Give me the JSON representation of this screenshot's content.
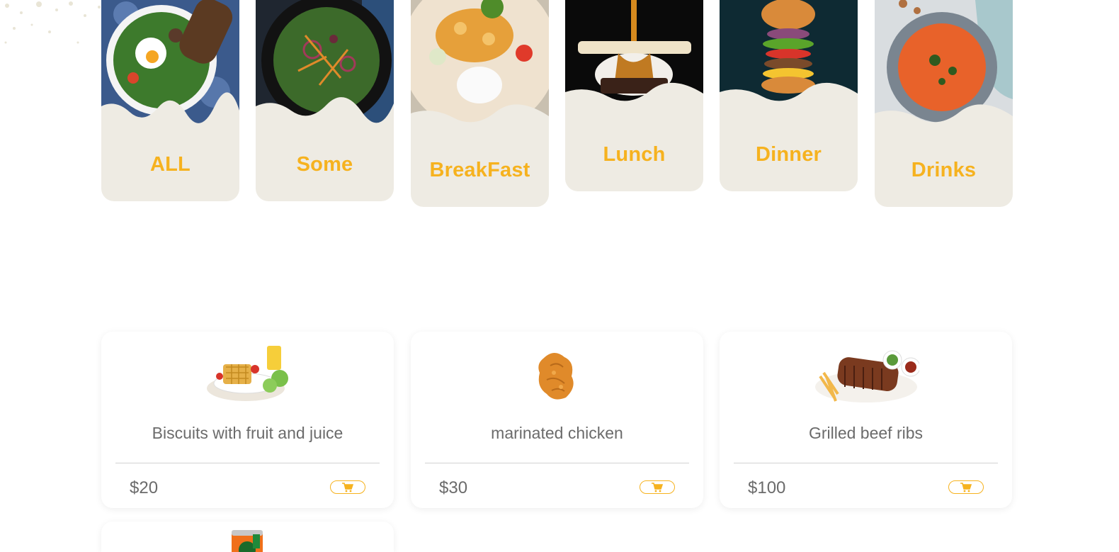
{
  "categories": [
    {
      "label": "ALL",
      "image": "salad-egg-bread-photo"
    },
    {
      "label": "Some",
      "image": "dark-salad-bowl-photo"
    },
    {
      "label": "BreakFast",
      "image": "rice-shrimp-plate-photo"
    },
    {
      "label": "Lunch",
      "image": "ice-cream-caramel-photo"
    },
    {
      "label": "Dinner",
      "image": "stacked-burger-photo"
    },
    {
      "label": "Drinks",
      "image": "tomato-soup-bowl-photo"
    }
  ],
  "menu_items": [
    {
      "name": "Biscuits with fruit and juice",
      "price": "$20",
      "image": "waffles-fruit-juice-photo"
    },
    {
      "name": "marinated chicken",
      "price": "$30",
      "image": "fried-chicken-photo"
    },
    {
      "name": "Grilled beef ribs",
      "price": "$100",
      "image": "beef-ribs-fries-photo"
    },
    {
      "name": "",
      "price": "",
      "image": "orange-can-photo"
    }
  ],
  "icons": {
    "cart": "shopping-cart-icon"
  },
  "colors": {
    "accent": "#f6b21f",
    "card_bg": "#eeebe3",
    "text": "#6b6b6b"
  }
}
